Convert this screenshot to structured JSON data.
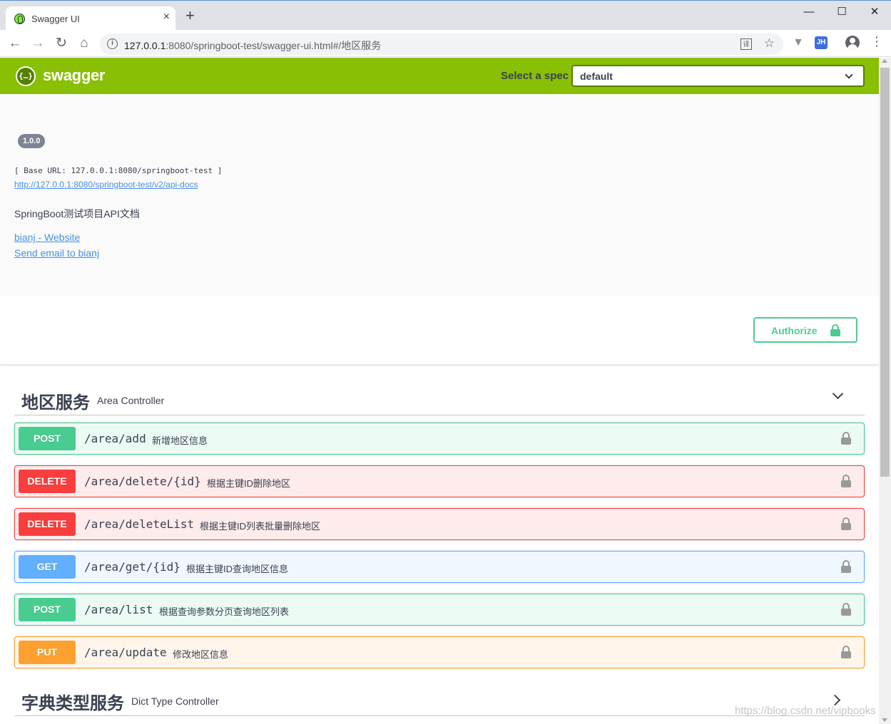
{
  "browser": {
    "tab_title": "Swagger UI",
    "tab_close": "×",
    "new_tab": "+",
    "win_min": "—",
    "win_max": "☐",
    "win_close": "✕",
    "url_host": "127.0.0.1",
    "url_rest": ":8080/springboot-test/swagger-ui.html#/地区服务",
    "ext_jh": "JH"
  },
  "topbar": {
    "logo_text": "swagger",
    "logo_glyph": "{…}",
    "spec_label": "Select a spec",
    "spec_value": "default"
  },
  "info": {
    "version": "1.0.0",
    "base_url": "[ Base URL: 127.0.0.1:8080/springboot-test ]",
    "api_docs_link": "http://127.0.0.1:8080/springboot-test/v2/api-docs",
    "description": "SpringBoot测试项目API文档",
    "contact_website": "bianj - Website",
    "contact_email": "Send email to bianj"
  },
  "auth": {
    "label": "Authorize"
  },
  "tags": [
    {
      "name": "地区服务",
      "description": "Area Controller",
      "expanded": true,
      "operations": [
        {
          "method": "POST",
          "path": "/area/add",
          "summary": "新增地区信息"
        },
        {
          "method": "DELETE",
          "path": "/area/delete/{id}",
          "summary": "根据主键ID删除地区"
        },
        {
          "method": "DELETE",
          "path": "/area/deleteList",
          "summary": "根据主键ID列表批量删除地区"
        },
        {
          "method": "GET",
          "path": "/area/get/{id}",
          "summary": "根据主键ID查询地区信息"
        },
        {
          "method": "POST",
          "path": "/area/list",
          "summary": "根据查询参数分页查询地区列表"
        },
        {
          "method": "PUT",
          "path": "/area/update",
          "summary": "修改地区信息"
        }
      ]
    },
    {
      "name": "字典类型服务",
      "description": "Dict Type Controller",
      "expanded": false
    }
  ],
  "watermark": "https://blog.csdn.net/vipbooks",
  "colors": {
    "topbar": "#89bf04",
    "post": "#49cc90",
    "delete": "#f93e3e",
    "get": "#61affe",
    "put": "#fca130",
    "link": "#4990e2"
  }
}
